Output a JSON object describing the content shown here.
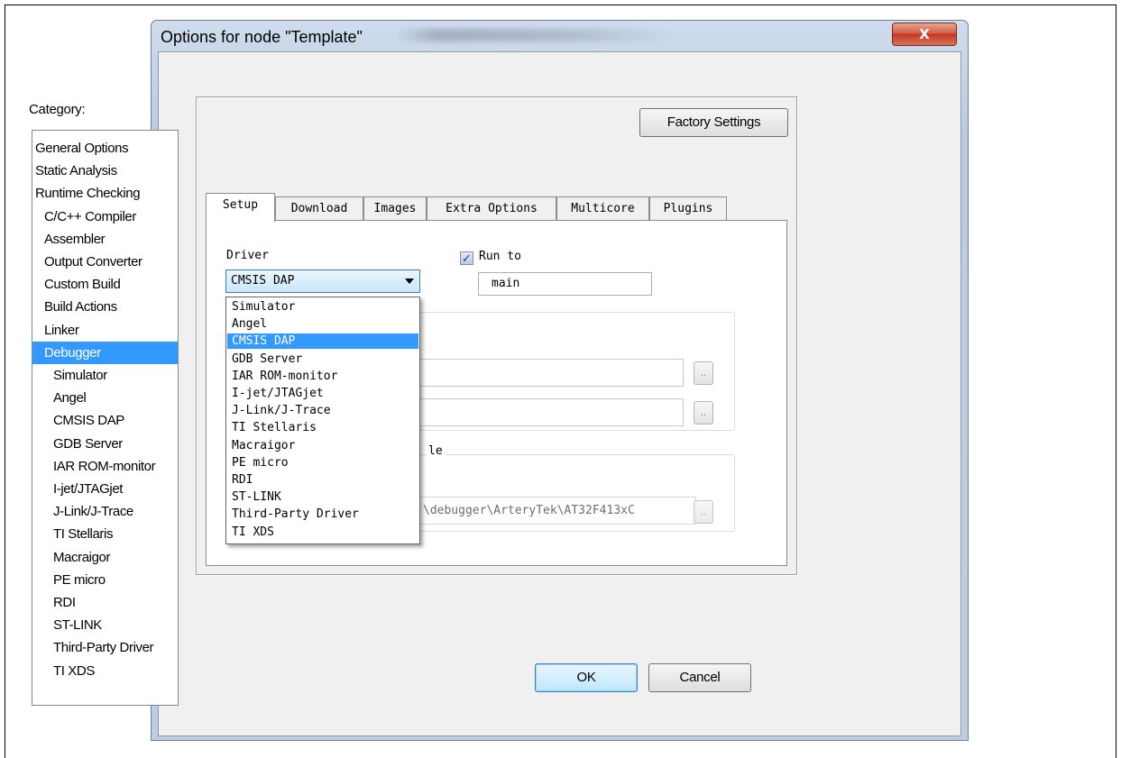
{
  "window": {
    "title": "Options for node \"Template\"",
    "close_glyph": "X"
  },
  "category": {
    "label": "Category:",
    "items": [
      {
        "label": "General Options",
        "indent": 0
      },
      {
        "label": "Static Analysis",
        "indent": 0
      },
      {
        "label": "Runtime Checking",
        "indent": 0
      },
      {
        "label": "C/C++ Compiler",
        "indent": 1
      },
      {
        "label": "Assembler",
        "indent": 1
      },
      {
        "label": "Output Converter",
        "indent": 1
      },
      {
        "label": "Custom Build",
        "indent": 1
      },
      {
        "label": "Build Actions",
        "indent": 1
      },
      {
        "label": "Linker",
        "indent": 1
      },
      {
        "label": "Debugger",
        "indent": 1,
        "selected": true
      },
      {
        "label": "Simulator",
        "indent": 2
      },
      {
        "label": "Angel",
        "indent": 2
      },
      {
        "label": "CMSIS DAP",
        "indent": 2
      },
      {
        "label": "GDB Server",
        "indent": 2
      },
      {
        "label": "IAR ROM-monitor",
        "indent": 2
      },
      {
        "label": "I-jet/JTAGjet",
        "indent": 2
      },
      {
        "label": "J-Link/J-Trace",
        "indent": 2
      },
      {
        "label": "TI Stellaris",
        "indent": 2
      },
      {
        "label": "Macraigor",
        "indent": 2
      },
      {
        "label": "PE micro",
        "indent": 2
      },
      {
        "label": "RDI",
        "indent": 2
      },
      {
        "label": "ST-LINK",
        "indent": 2
      },
      {
        "label": "Third-Party Driver",
        "indent": 2
      },
      {
        "label": "TI XDS",
        "indent": 2
      }
    ]
  },
  "buttons": {
    "factory_settings": "Factory Settings",
    "ok": "OK",
    "cancel": "Cancel",
    "browse": ".."
  },
  "tabs": [
    {
      "label": "Setup",
      "active": true
    },
    {
      "label": "Download"
    },
    {
      "label": "Images"
    },
    {
      "label": "Extra Options"
    },
    {
      "label": "Multicore"
    },
    {
      "label": "Plugins"
    }
  ],
  "setup": {
    "driver_label": "Driver",
    "driver_value": "CMSIS DAP",
    "run_to_checked": true,
    "run_to_check_glyph": "✓",
    "run_to_label": "Run to",
    "run_to_value": "main",
    "group2_legend_fragment": "le",
    "path_fragment": "\\debugger\\ArteryTek\\AT32F413xC"
  },
  "driver_options": [
    "Simulator",
    "Angel",
    "CMSIS DAP",
    "GDB Server",
    "IAR ROM-monitor",
    "I-jet/JTAGjet",
    "J-Link/J-Trace",
    "TI Stellaris",
    "Macraigor",
    "PE micro",
    "RDI",
    "ST-LINK",
    "Third-Party Driver",
    "TI XDS"
  ],
  "driver_selected_index": 2,
  "colors": {
    "selection": "#3399ff",
    "close_button": "#c0391f"
  }
}
